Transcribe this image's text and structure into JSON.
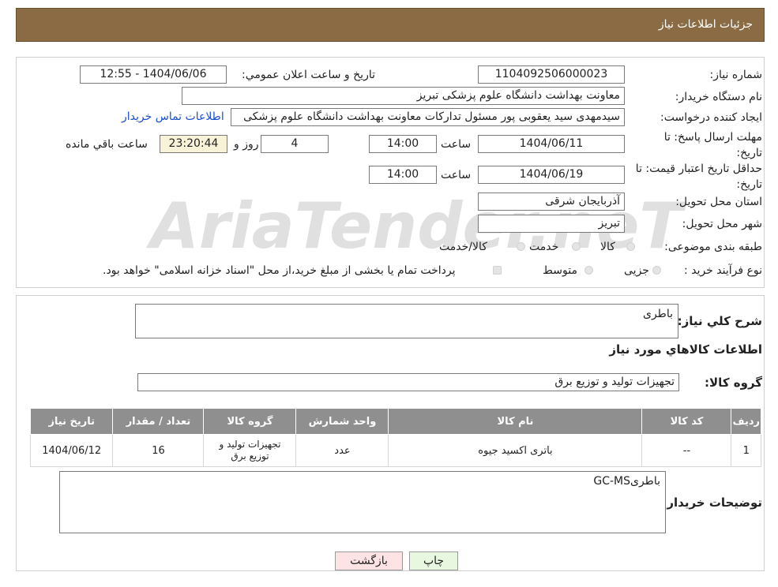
{
  "header": {
    "title": "جزئیات اطلاعات نیاز"
  },
  "watermark": "AriaTender.neT",
  "form": {
    "need_number_label": "شماره نیاز:",
    "need_number": "1104092506000023",
    "announce_label": "تاریخ و ساعت اعلان عمومي:",
    "announce_value": "1404/06/06 - 12:55",
    "buyer_org_label": "نام دستگاه خریدار:",
    "buyer_org": "معاونت بهداشت دانشگاه علوم پزشکی تبریز",
    "requester_label": "ایجاد کننده درخواست:",
    "requester": "سیدمهدی سید یعقوبی پور مسئول تدارکات معاونت بهداشت دانشگاه علوم پزشکی",
    "contact_link": "اطلاعات تماس خریدار",
    "reply_deadline_label": "مهلت ارسال پاسخ: تا تاریخ:",
    "reply_date": "1404/06/11",
    "time_label": "ساعت",
    "reply_time": "14:00",
    "days": "4",
    "days_label": "روز و",
    "remaining_time": "23:20:44",
    "remaining_label": "ساعت باقي مانده",
    "validity_label": "حداقل تاریخ اعتبار قیمت: تا تاریخ:",
    "validity_date": "1404/06/19",
    "validity_time": "14:00",
    "province_label": "استان محل تحویل:",
    "province": "آذربایجان شرقی",
    "city_label": "شهر محل تحویل:",
    "city": "تبریز",
    "category_label": "طبقه بندی موضوعی:",
    "category_options": [
      "کالا",
      "خدمت",
      "کالا/خدمت"
    ],
    "process_label": "نوع فرآیند خرید :",
    "process_options": [
      "جزیی",
      "متوسط"
    ],
    "payment_note": "پرداخت تمام یا بخشی از مبلغ خرید،از محل \"اسناد خزانه اسلامی\" خواهد بود."
  },
  "details": {
    "summary_label": "شرح کلي نياز:",
    "summary": "باطری",
    "items_title": "اطلاعات کالاهاي مورد نياز",
    "group_label": "گروه کالا:",
    "group": "تجهیزات تولید و توزیع برق",
    "table": {
      "headers": [
        "رديف",
        "کد کالا",
        "نام کالا",
        "واحد شمارش",
        "گروه کالا",
        "تعداد / مقدار",
        "تاریخ نیاز"
      ],
      "rows": [
        [
          "1",
          "--",
          "باتری اکسید جیوه",
          "عدد",
          "تجهیزات تولید و توزیع برق",
          "16",
          "1404/06/12"
        ]
      ]
    },
    "buyer_notes_label": "توضیحات خریدار:",
    "buyer_notes": "باطریGC-MS"
  },
  "buttons": {
    "print": "چاپ",
    "back": "بازگشت"
  },
  "colors": {
    "header": "#8b6b44",
    "table_header": "#8f8f8f",
    "print_button": "#e8f7e0",
    "back_button": "#fde3e3"
  }
}
